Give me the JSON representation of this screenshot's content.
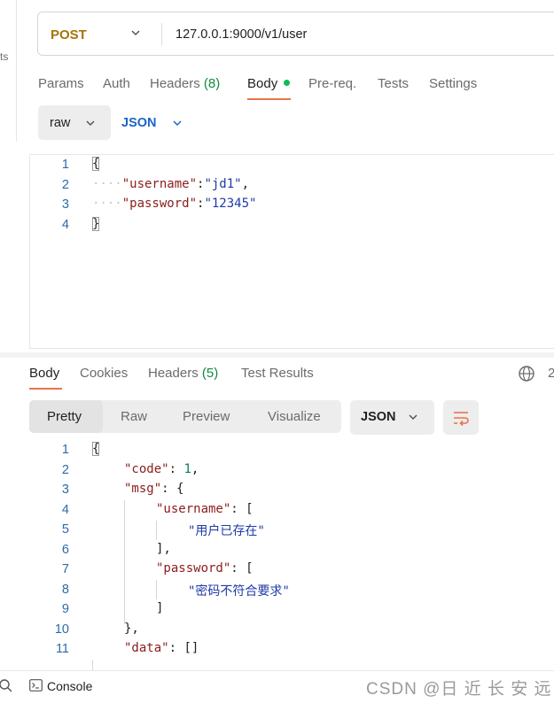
{
  "sidebar": {
    "fragment": "ts"
  },
  "request": {
    "method": "POST",
    "url": "127.0.0.1:9000/v1/user"
  },
  "request_tabs": {
    "params": "Params",
    "auth": "Auth",
    "headers": "Headers",
    "headers_count": "(8)",
    "body": "Body",
    "prereq": "Pre-req.",
    "tests": "Tests",
    "settings": "Settings"
  },
  "body_options": {
    "mode": "raw",
    "language": "JSON"
  },
  "request_body": {
    "line_numbers": [
      "1",
      "2",
      "3",
      "4"
    ],
    "open_brace": "{",
    "close_brace": "}",
    "k1": "\"username\"",
    "v1": "\"jd1\"",
    "k2": "\"password\"",
    "v2": "\"12345\""
  },
  "response_tabs": {
    "body": "Body",
    "cookies": "Cookies",
    "headers": "Headers",
    "headers_count": "(5)",
    "test_results": "Test Results",
    "status_fragment": "2"
  },
  "response_view": {
    "modes": [
      "Pretty",
      "Raw",
      "Preview",
      "Visualize"
    ],
    "format": "JSON"
  },
  "response_body": {
    "line_numbers": [
      "1",
      "2",
      "3",
      "4",
      "5",
      "6",
      "7",
      "8",
      "9",
      "10",
      "11"
    ],
    "code_key": "\"code\"",
    "code_val": "1",
    "msg_key": "\"msg\"",
    "username_key": "\"username\"",
    "username_msg": "\"用户已存在\"",
    "password_key": "\"password\"",
    "password_msg": "\"密码不符合要求\"",
    "data_key": "\"data\"",
    "data_val": "[]"
  },
  "statusbar": {
    "console": "Console",
    "watermark": "CSDN @日 近 长 安 远"
  }
}
